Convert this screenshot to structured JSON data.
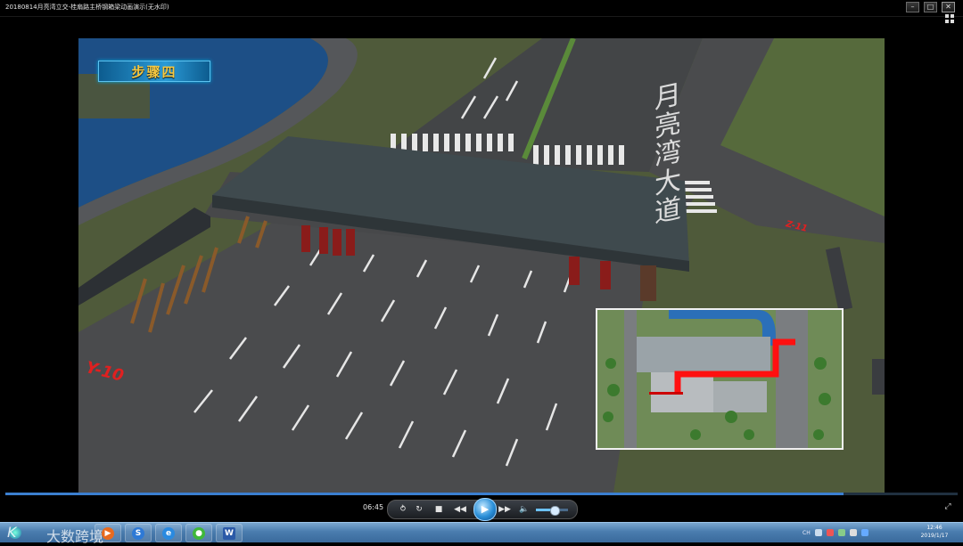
{
  "window": {
    "title": "20180814月亮湾立交-桂扇路主桥钢箱梁动画演示(无水印)",
    "buttons": [
      "–",
      "□",
      "✕"
    ]
  },
  "video": {
    "step_label": "步骤四",
    "pier_labels": {
      "left": "Y-10",
      "right": "Z-11"
    },
    "road_sign": "月亮湾大道"
  },
  "player": {
    "current_time": "06:45",
    "progress": 0.88,
    "volume": 0.55,
    "controls": {
      "repeat": "repeat-icon",
      "refresh": "refresh-icon",
      "stop": "stop-icon",
      "rewind": "rewind-icon",
      "play": "play-icon",
      "fast_forward": "fast-forward-icon",
      "volume": "speaker-icon"
    }
  },
  "taskbar": {
    "watermark": "大数跨境",
    "apps": [
      "start-orb",
      "media-player-icon",
      "sogou-icon",
      "ie-icon",
      "wechat-icon",
      "word-icon"
    ],
    "tray_lang": "CH",
    "clock": {
      "time": "12:46",
      "date": "2019/1/17"
    }
  },
  "colors": {
    "accent": "#2a9ad6",
    "step_text": "#f5c842",
    "pier_label": "#e02020",
    "minimap_route": "#ff1010"
  }
}
